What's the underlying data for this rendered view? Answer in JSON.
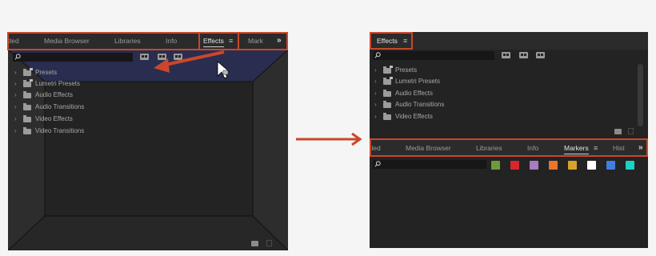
{
  "left_panel": {
    "tabs": [
      "tled",
      "Media Browser",
      "Libraries",
      "Info",
      "Effects",
      "Mark"
    ],
    "active_tab": "Effects",
    "menu_icon": "≡",
    "overflow_icon": "»",
    "items": [
      {
        "label": "Presets",
        "icon": "folder-stack-icon"
      },
      {
        "label": "Lumetri Presets",
        "icon": "folder-stack-icon"
      },
      {
        "label": "Audio Effects",
        "icon": "folder-icon"
      },
      {
        "label": "Audio Transitions",
        "icon": "folder-icon"
      },
      {
        "label": "Video Effects",
        "icon": "folder-icon"
      },
      {
        "label": "Video Transitions",
        "icon": "folder-icon"
      }
    ]
  },
  "right_panel": {
    "top_tab": "Effects",
    "top_menu_icon": "≡",
    "items": [
      {
        "label": "Presets",
        "icon": "folder-stack-icon"
      },
      {
        "label": "Lumetri Presets",
        "icon": "folder-stack-icon"
      },
      {
        "label": "Audio Effects",
        "icon": "folder-icon"
      },
      {
        "label": "Audio Transitions",
        "icon": "folder-icon"
      },
      {
        "label": "Video Effects",
        "icon": "folder-icon"
      }
    ],
    "tabs": [
      "tled",
      "Media Browser",
      "Libraries",
      "Info",
      "Markers",
      "Hist"
    ],
    "active_tab": "Markers",
    "menu_icon": "≡",
    "overflow_icon": "»",
    "marker_colors": [
      "#6f9a3a",
      "#d8262f",
      "#a77cc0",
      "#e8762d",
      "#d9a22b",
      "#ffffff",
      "#3f7fe0",
      "#19d3c5"
    ]
  },
  "colors": {
    "annotation": "#c9472b",
    "panel_bg": "#232323",
    "drop_zone": "#2a2e52"
  }
}
